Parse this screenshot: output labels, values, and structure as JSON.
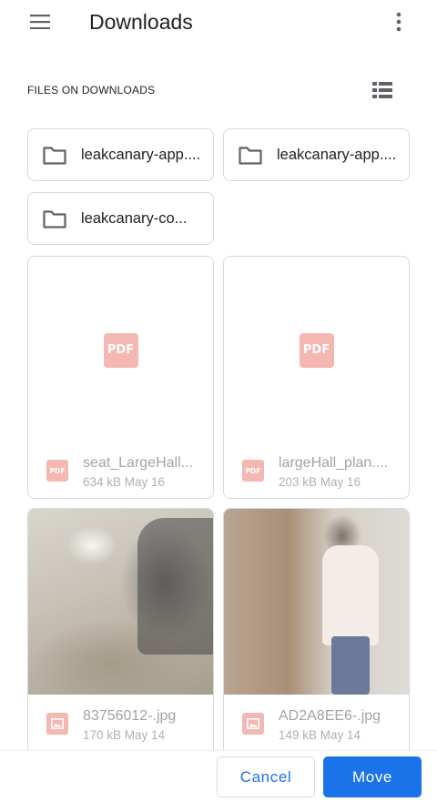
{
  "appbar": {
    "title": "Downloads",
    "menu_icon": "hamburger-menu-icon",
    "overflow_icon": "more-vert-icon"
  },
  "section": {
    "title": "FILES ON DOWNLOADS",
    "view_toggle_icon": "list-view-icon"
  },
  "folders": [
    {
      "label": "leakcanary-app....",
      "icon": "folder-icon"
    },
    {
      "label": "leakcanary-app....",
      "icon": "folder-icon"
    },
    {
      "label": "leakcanary-co...",
      "icon": "folder-icon"
    }
  ],
  "files": [
    {
      "name": "seat_LargeHall...",
      "size_date": "634 kB May 16",
      "type": "pdf",
      "thumb_text": "PDF"
    },
    {
      "name": "largeHall_plan....",
      "size_date": "203 kB May 16",
      "type": "pdf",
      "thumb_text": "PDF"
    },
    {
      "name": "83756012-.jpg",
      "size_date": "170 kB May 14",
      "type": "image"
    },
    {
      "name": "AD2A8EE6-.jpg",
      "size_date": "149 kB May 14",
      "type": "image"
    }
  ],
  "actions": {
    "cancel_label": "Cancel",
    "move_label": "Move"
  },
  "colors": {
    "accent": "#1a73e8",
    "pdf_tint": "#f4b7b2",
    "border": "#d8d8d8"
  }
}
